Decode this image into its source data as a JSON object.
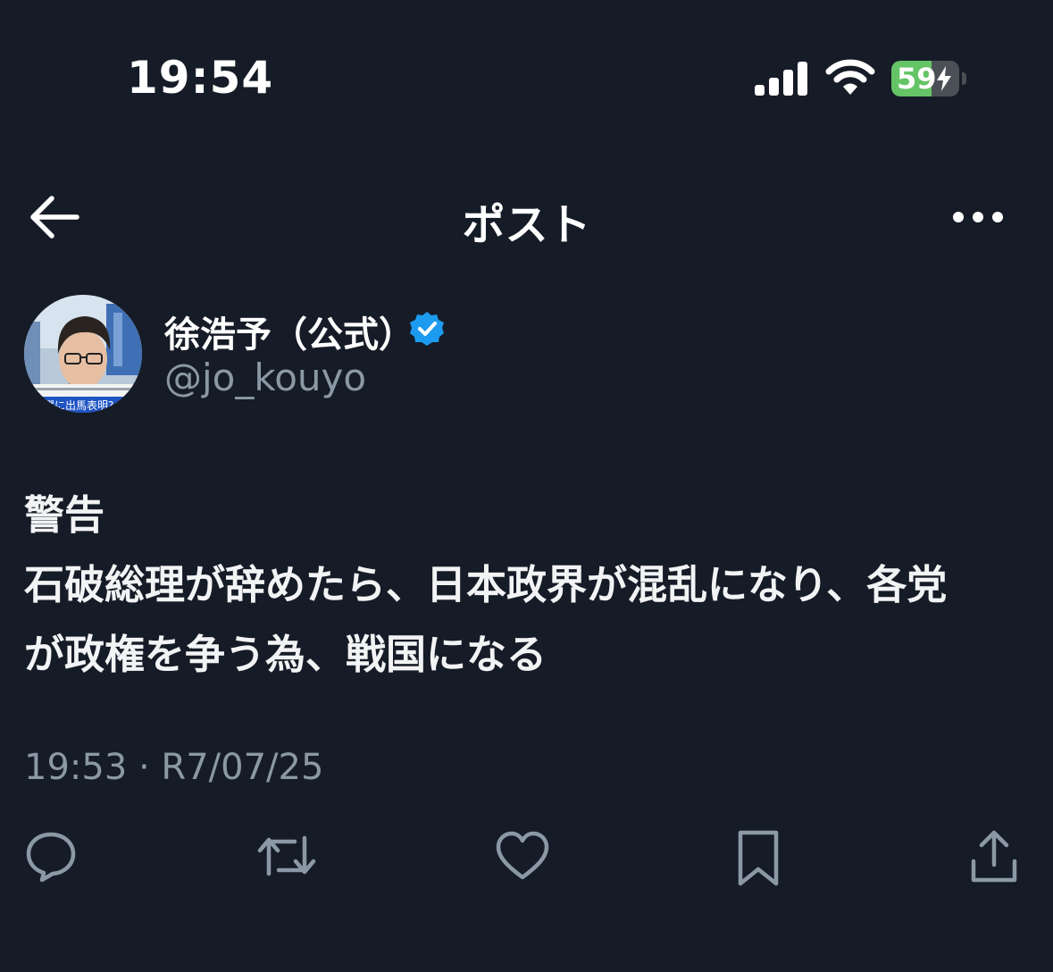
{
  "status_bar": {
    "time": "19:54",
    "battery_percent": "59",
    "battery_level": 0.59,
    "charging": true
  },
  "header": {
    "title": "ポスト",
    "back_icon": "arrow-left-icon",
    "more_icon": "more-horizontal-icon"
  },
  "author": {
    "display_name": "徐浩予（公式）",
    "handle": "@jo_kouyo",
    "verified": true,
    "avatar_caption": "長選に出馬表明? "
  },
  "post": {
    "lines": [
      "警告",
      "石破総理が辞めたら、日本政界が混乱になり、各党",
      "が政権を争う為、戦国になる"
    ],
    "timestamp": "19:53 · R7/07/25"
  },
  "actions": [
    {
      "name": "reply",
      "icon": "reply-bubble-icon"
    },
    {
      "name": "repost",
      "icon": "repost-icon"
    },
    {
      "name": "like",
      "icon": "heart-icon"
    },
    {
      "name": "bookmark",
      "icon": "bookmark-icon"
    },
    {
      "name": "share",
      "icon": "share-icon"
    }
  ],
  "colors": {
    "background": "#161c27",
    "text_primary": "#e7e9ea",
    "text_secondary": "#8b98a5",
    "verified_blue": "#1d9bf0",
    "battery_green": "#65c466"
  }
}
